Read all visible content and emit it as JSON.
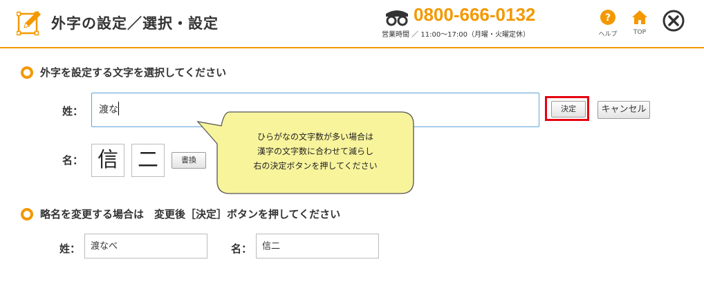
{
  "header": {
    "title": "外字の設定／選択・設定",
    "phone": "0800-666-0132",
    "hours": "営業時間 ／ 11:00〜17:00（月曜・火曜定休）",
    "help_label": "ヘルプ",
    "top_label": "TOP",
    "accent_color": "#f39800",
    "icons": [
      "edit-icon",
      "free-dial-icon",
      "help-icon",
      "home-icon",
      "close-icon"
    ]
  },
  "section1": {
    "title": "外字を設定する文字を選択してください",
    "surname_label": "姓：",
    "surname_value": "渡な",
    "decide_button": "決定",
    "cancel_button": "キャンセル",
    "given_label": "名：",
    "given_chars": [
      "信",
      "二"
    ],
    "rewrite_button": "書換"
  },
  "tooltip": {
    "line1": "ひらがなの文字数が多い場合は",
    "line2": "漢字の文字数に合わせて減らし",
    "line3": "右の決定ボタンを押してください"
  },
  "section2": {
    "title": "略名を変更する場合は　変更後［決定］ボタンを押してください",
    "surname_label": "姓：",
    "surname_value": "渡なべ",
    "given_label": "名：",
    "given_value": "信二"
  }
}
